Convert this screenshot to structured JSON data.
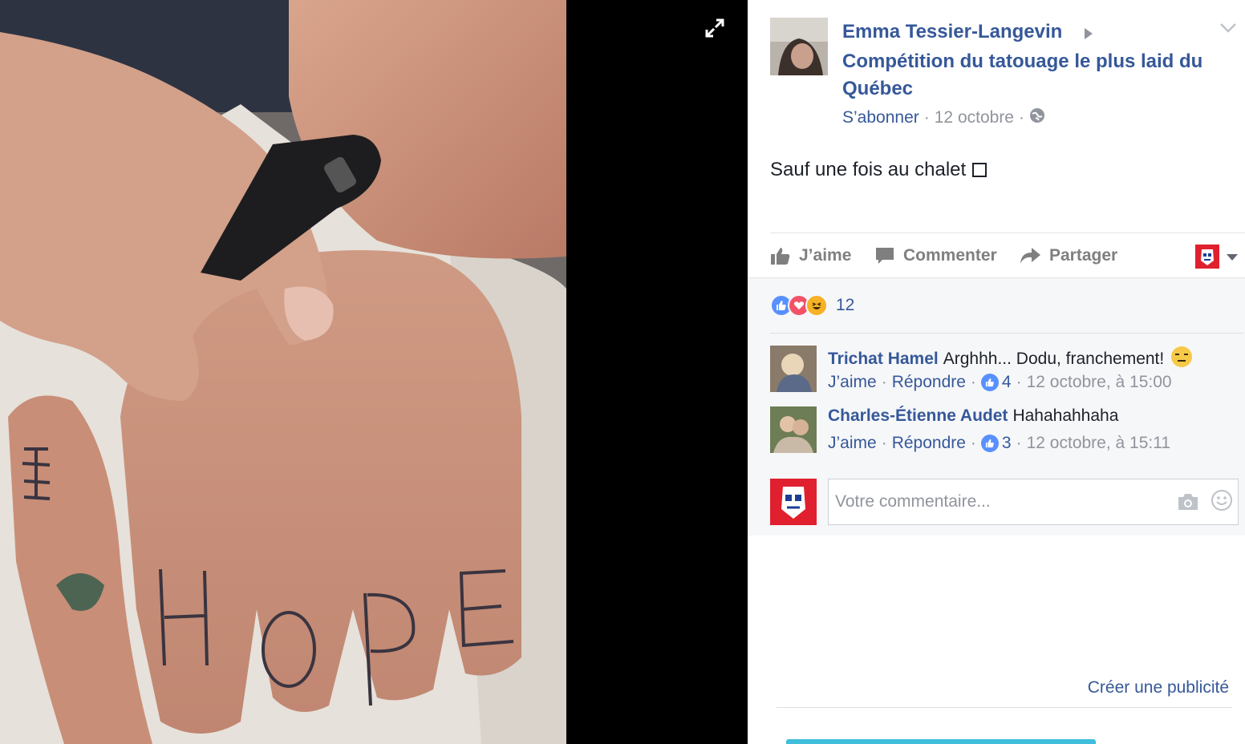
{
  "post": {
    "author": "Emma Tessier-Langevin",
    "group": "Compétition du tatouage le plus laid du Québec",
    "follow": "S’abonner",
    "date": "12 octobre",
    "text": "Sauf une fois au chalet",
    "photo_tattoo_text": "HOPE"
  },
  "actions": {
    "like": "J’aime",
    "comment": "Commenter",
    "share": "Partager"
  },
  "reactions": {
    "types": [
      "like",
      "love",
      "haha"
    ],
    "count": "12"
  },
  "comments": [
    {
      "name": "Trichat Hamel",
      "text": "Arghhh... Dodu, franchement!",
      "like": "J’aime",
      "reply": "Répondre",
      "likes": "4",
      "time": "12 octobre, à 15:00"
    },
    {
      "name": "Charles-Étienne Audet",
      "text": "Hahahahhaha",
      "like": "J’aime",
      "reply": "Répondre",
      "likes": "3",
      "time": "12 octobre, à 15:11"
    }
  ],
  "comment_box": {
    "placeholder": "Votre commentaire..."
  },
  "sidebar": {
    "create_ad": "Créer une publicité"
  },
  "colors": {
    "link": "#365899",
    "meta": "#90949c",
    "comments_bg": "#f6f7f9",
    "like_blue": "#5890ff",
    "love_red": "#f25268",
    "haha_yellow": "#f7b125"
  }
}
